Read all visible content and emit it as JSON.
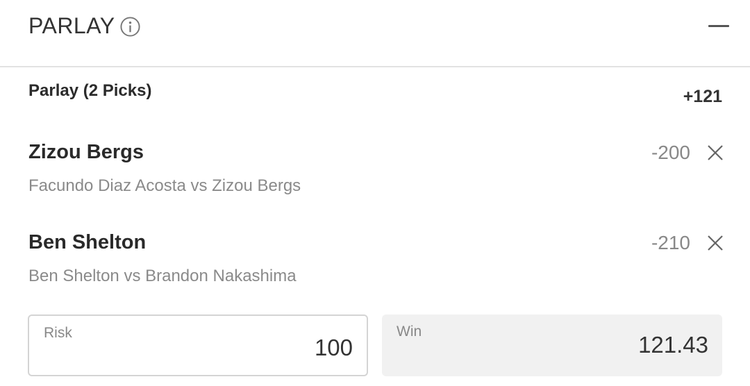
{
  "header": {
    "title": "PARLAY",
    "info_icon": "info-circle-icon",
    "collapse_icon": "minus-icon"
  },
  "parlay": {
    "label": "Parlay (2 Picks)",
    "odds": "+121"
  },
  "picks": [
    {
      "name": "Zizou Bergs",
      "odds": "-200",
      "match": "Facundo Diaz Acosta vs Zizou Bergs",
      "remove_icon": "close-icon"
    },
    {
      "name": "Ben Shelton",
      "odds": "-210",
      "match": "Ben Shelton vs Brandon Nakashima",
      "remove_icon": "close-icon"
    }
  ],
  "wager": {
    "risk_label": "Risk",
    "risk_value": "100",
    "win_label": "Win",
    "win_value": "121.43"
  },
  "colors": {
    "divider": "#e2e2e2",
    "muted_text": "#8a8a8a",
    "win_background": "#f1f1f1"
  }
}
